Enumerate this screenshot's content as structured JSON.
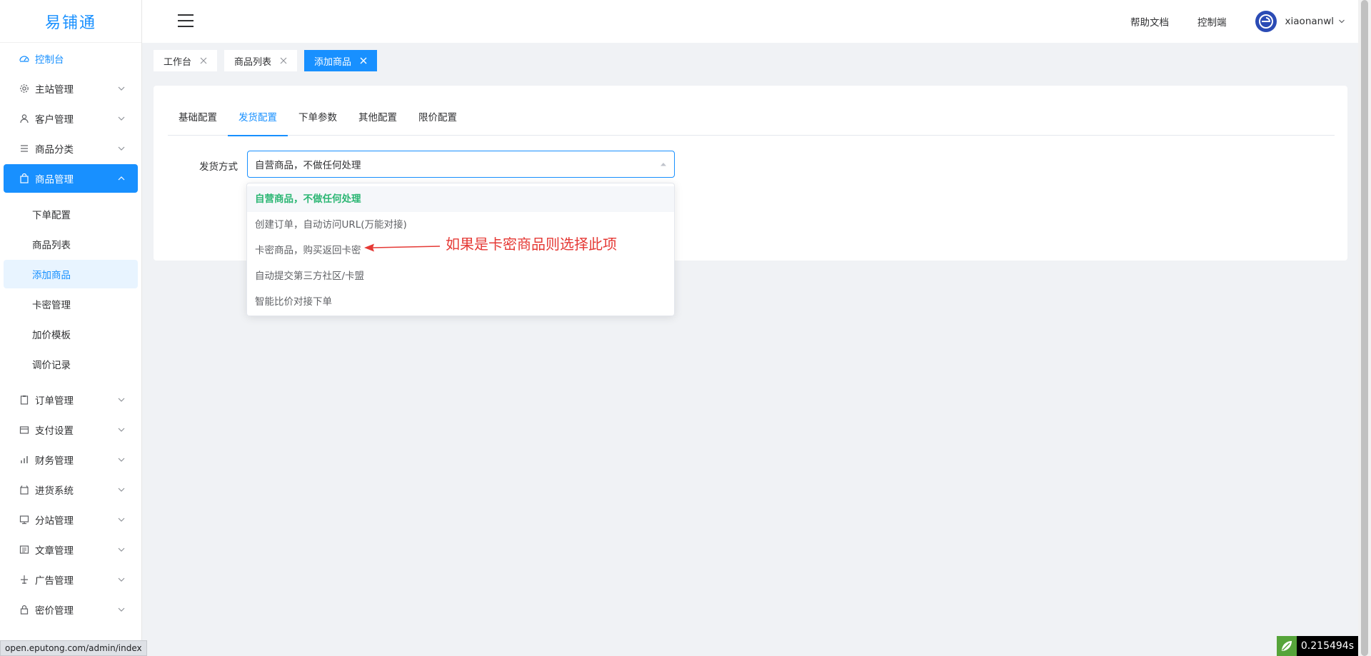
{
  "app": {
    "logo_text": "易铺通",
    "brand_color": "#1890ff"
  },
  "sidebar": {
    "items": [
      {
        "label": "控制台",
        "icon": "dashboard-icon"
      },
      {
        "label": "主站管理",
        "icon": "gear-icon"
      },
      {
        "label": "客户管理",
        "icon": "user-icon"
      },
      {
        "label": "商品分类",
        "icon": "list-icon"
      },
      {
        "label": "商品管理",
        "icon": "bag-icon"
      },
      {
        "label": "订单管理",
        "icon": "clipboard-icon"
      },
      {
        "label": "支付设置",
        "icon": "wallet-icon"
      },
      {
        "label": "财务管理",
        "icon": "bar-chart-icon"
      },
      {
        "label": "进货系统",
        "icon": "box-icon"
      },
      {
        "label": "分站管理",
        "icon": "monitor-icon"
      },
      {
        "label": "文章管理",
        "icon": "document-icon"
      },
      {
        "label": "广告管理",
        "icon": "plane-icon"
      },
      {
        "label": "密价管理",
        "icon": "lock-icon"
      }
    ],
    "submenu": [
      "下单配置",
      "商品列表",
      "添加商品",
      "卡密管理",
      "加价模板",
      "调价记录"
    ]
  },
  "header": {
    "help_docs": "帮助文档",
    "console": "控制端",
    "username": "xiaonanwl"
  },
  "tags": [
    "工作台",
    "商品列表",
    "添加商品"
  ],
  "tabs": [
    "基础配置",
    "发货配置",
    "下单参数",
    "其他配置",
    "限价配置"
  ],
  "form": {
    "delivery_label": "发货方式",
    "delivery_value": "自营商品，不做任何处理"
  },
  "dropdown": {
    "options": [
      "自营商品，不做任何处理",
      "创建订单，自动访问URL(万能对接)",
      "卡密商品，购买返回卡密",
      "自动提交第三方社区/卡盟",
      "智能比价对接下单"
    ]
  },
  "annotation": {
    "text": "如果是卡密商品则选择此项",
    "color": "#e53935"
  },
  "status_url": "open.eputong.com/admin/index",
  "timer_value": "0.215494s"
}
